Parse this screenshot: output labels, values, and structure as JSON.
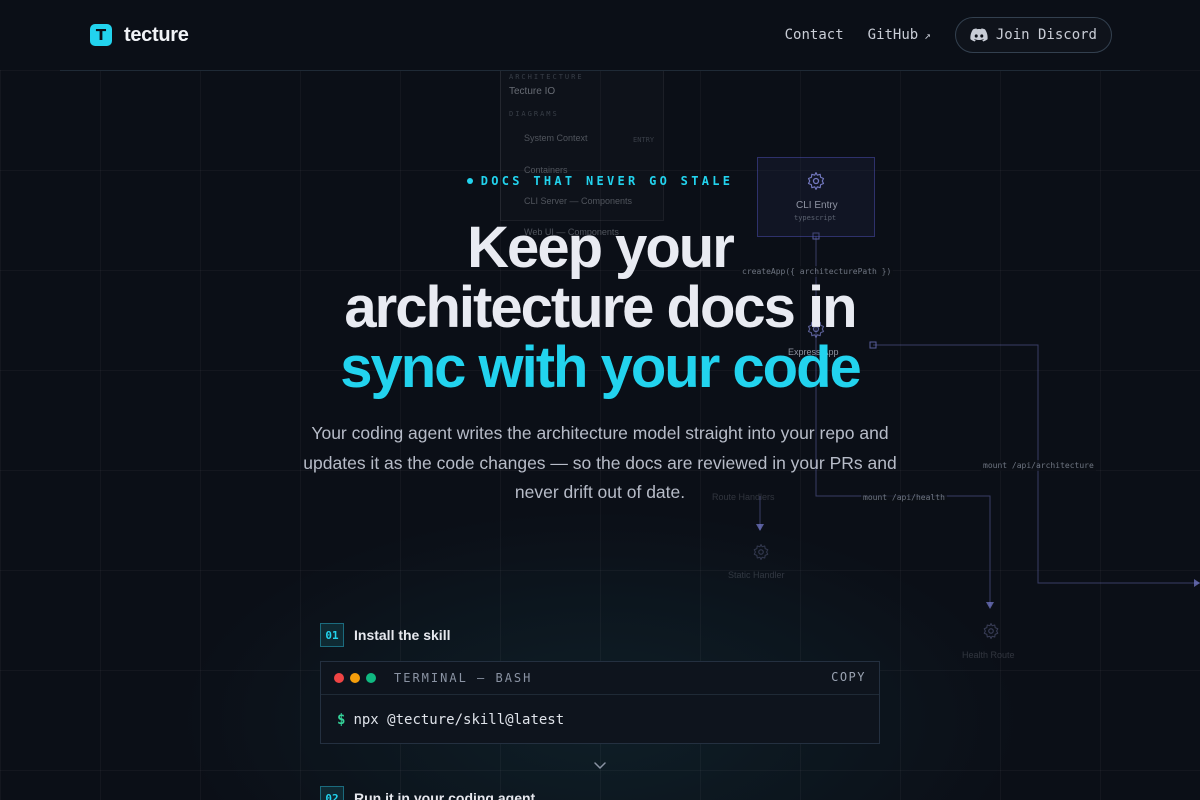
{
  "nav": {
    "brand_name": "tecture",
    "brand_logo_letter": "T",
    "contact_label": "Contact",
    "github_label": "GitHub",
    "github_arrow": "↗",
    "discord_label": "Join Discord"
  },
  "diagram": {
    "panel_heading": "ARCHITECTURE",
    "panel_title": "Tecture IO",
    "panel_subheading": "DIAGRAMS",
    "panel_item_1": "System Context",
    "panel_item_1_badge": "ENTRY",
    "panel_item_2": "Containers",
    "panel_item_3": "CLI Server — Components",
    "panel_item_4": "Web UI — Components",
    "node_cli_label": "CLI Entry",
    "node_cli_sub": "typescript",
    "node_express_label": "Express App",
    "edge_create_app": "createApp({ architecturePath })",
    "edge_mount_arch": "mount /api/architecture",
    "edge_mount_health": "mount /api/health",
    "node_route_handlers": "Route Handlers",
    "node_static_handler": "Static Handler",
    "node_health_route": "Health Route"
  },
  "hero": {
    "eyebrow": "DOCS THAT NEVER GO STALE",
    "headline_line1": "Keep your",
    "headline_line2": "architecture docs in",
    "headline_line3": "sync with your code",
    "subtitle": "Your coding agent writes the architecture model straight into your repo and updates it as the code changes — so the docs are reviewed in your PRs and never drift out of date."
  },
  "steps": [
    {
      "number": "01",
      "title": "Install the skill"
    },
    {
      "number": "02",
      "title": "Run it in your coding agent"
    }
  ],
  "terminal": {
    "title": "TERMINAL — BASH",
    "copy_label": "COPY",
    "prompt": "$",
    "command": "npx @tecture/skill@latest"
  },
  "colors": {
    "background": "#0b0f17",
    "accent": "#22d3ee",
    "prompt_green": "#34d399",
    "dot_red": "#ef4444",
    "dot_yellow": "#f59e0b",
    "dot_green": "#10b981"
  }
}
